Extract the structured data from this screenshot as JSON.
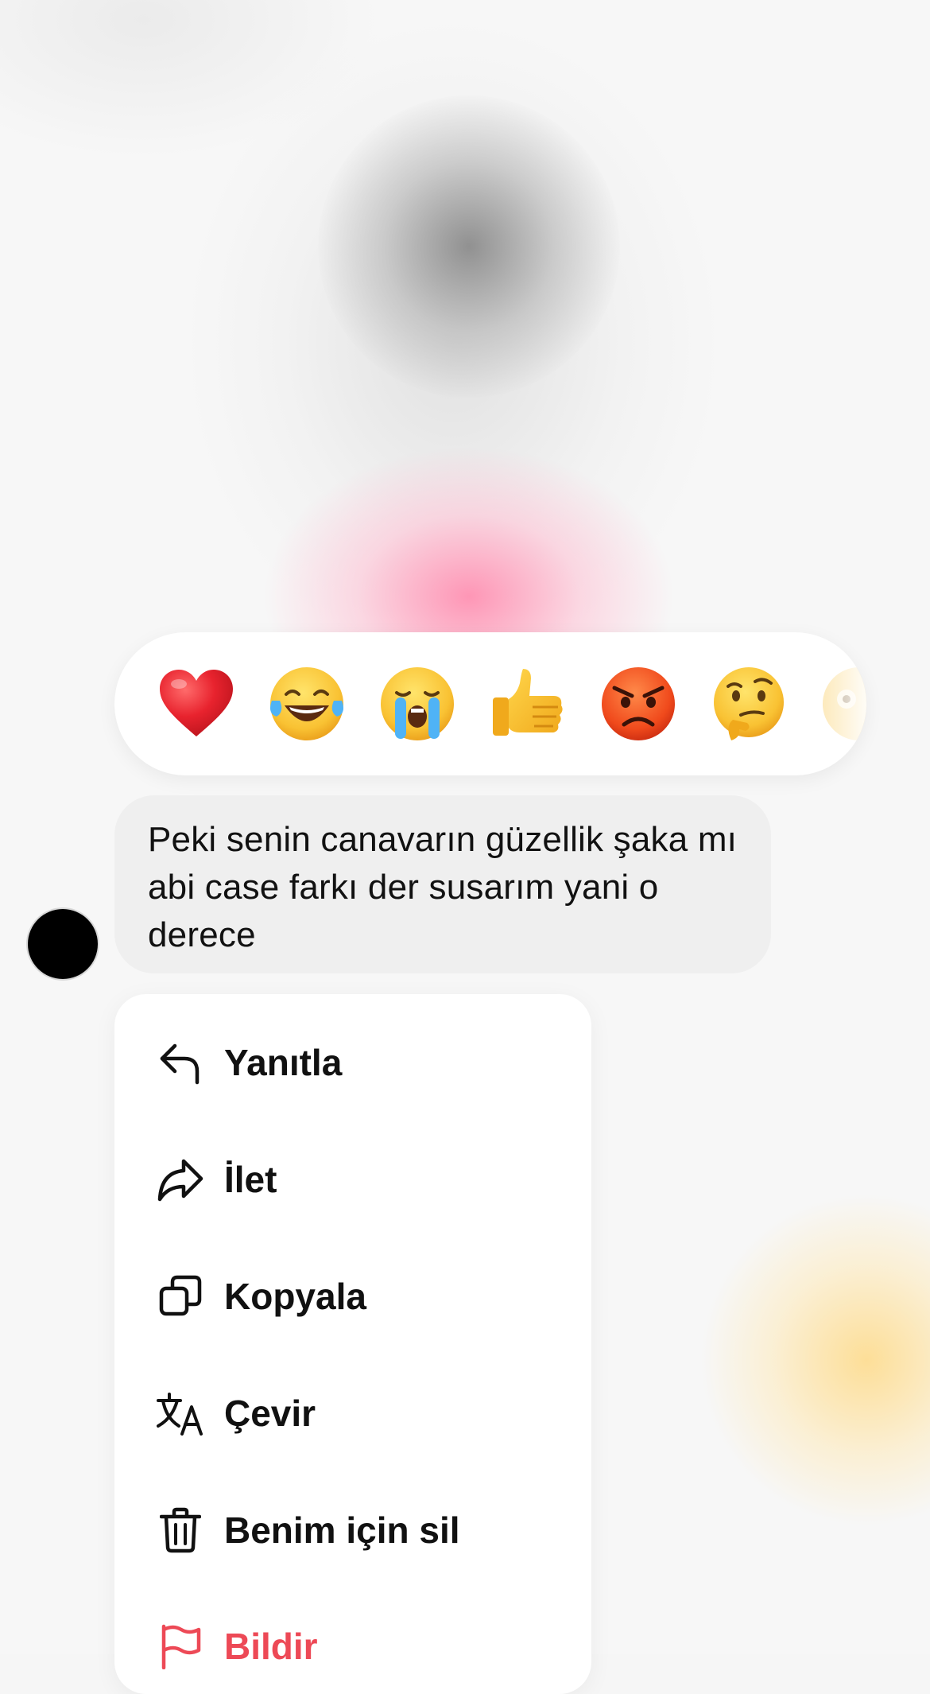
{
  "reactions": [
    {
      "name": "red-heart",
      "glyph": "❤️"
    },
    {
      "name": "face-with-tears-of-joy",
      "glyph": "😂"
    },
    {
      "name": "loudly-crying-face",
      "glyph": "😭"
    },
    {
      "name": "thumbs-up",
      "glyph": "👍"
    },
    {
      "name": "angry-face",
      "glyph": "😡"
    },
    {
      "name": "thinking-face",
      "glyph": "🤔"
    },
    {
      "name": "astonished-face",
      "glyph": "😳"
    }
  ],
  "message": {
    "text": "Peki senin canavarın güzellik şaka mı abi case farkı der susarım yani o derece"
  },
  "menu": {
    "reply": "Yanıtla",
    "forward": "İlet",
    "copy": "Kopyala",
    "translate": "Çevir",
    "delete": "Benim için sil",
    "report": "Bildir"
  },
  "colors": {
    "danger": "#ed4956",
    "bubble": "#efefef",
    "text": "#111111"
  }
}
